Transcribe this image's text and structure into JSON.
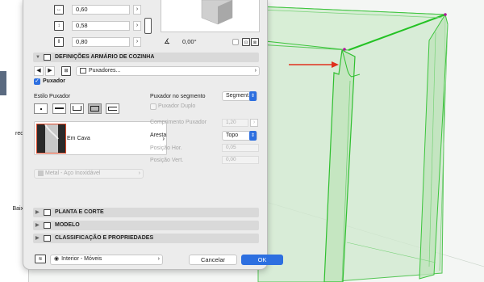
{
  "accent_color": "#2d6fe0",
  "left_panel": {
    "label_1": "rede",
    "label_2": "Baixo"
  },
  "dimensions": {
    "width": "0,60",
    "depth": "0,58",
    "height": "0,80",
    "angle": "0,00°"
  },
  "sections": {
    "kitchen": "DEFINIÇÕES ARMÁRIO DE COZINHA",
    "plan": "PLANTA E CORTE",
    "model": "MODELO",
    "classification": "CLASSIFICAÇÃO E PROPRIEDADES"
  },
  "nav": {
    "dropdown": "Puxadores..."
  },
  "handle": {
    "checkbox_label": "Puxador",
    "style_label": "Estilo Puxador",
    "type_name": "Em Cava",
    "material": "Metal - Aço Inoxidável"
  },
  "right_params": {
    "segment_label": "Puxador no segmento",
    "segment_value": "Segment...",
    "double_label": "Puxador Duplo",
    "length_label": "Comprimento Puxador",
    "length_value": "1,20",
    "edge_label": "Aresta",
    "edge_value": "Topo",
    "hpos_label": "Posição Hor.",
    "hpos_value": "0,05",
    "vpos_label": "Posição Vert.",
    "vpos_value": "0,00"
  },
  "footer": {
    "layer": "Interior - Móveis",
    "cancel": "Cancelar",
    "ok": "OK"
  }
}
